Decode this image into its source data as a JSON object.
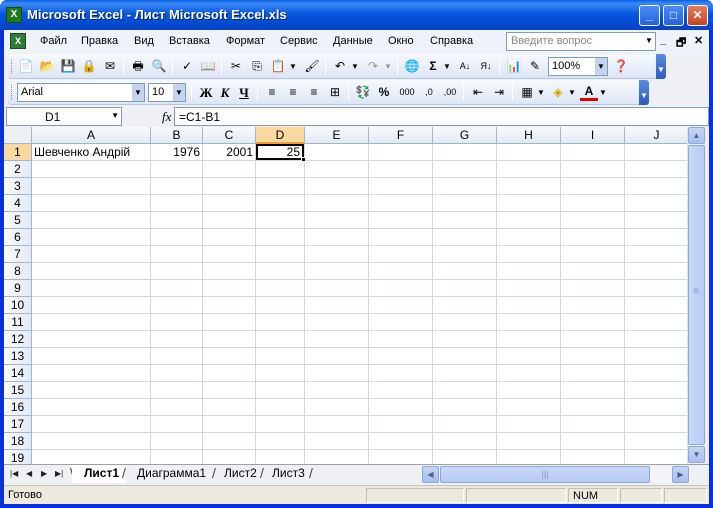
{
  "window": {
    "title": "Microsoft Excel - Лист Microsoft Excel.xls",
    "minimize": "_",
    "maximize": "□",
    "close": "✕"
  },
  "menu": {
    "items": [
      "Файл",
      "Правка",
      "Вид",
      "Вставка",
      "Формат",
      "Сервис",
      "Данные",
      "Окно",
      "Справка"
    ],
    "help_placeholder": "Введите вопрос",
    "doc_controls": [
      "_",
      "🗗",
      "✕"
    ]
  },
  "toolbar_standard": {
    "zoom": "100%"
  },
  "toolbar_format": {
    "font": "Arial",
    "size": "10",
    "bold": "Ж",
    "italic": "К",
    "underline": "Ч",
    "percent": "%",
    "thousands": "000"
  },
  "formula_bar": {
    "name_box": "D1",
    "fx": "fx",
    "formula": "=C1-B1"
  },
  "columns": [
    "A",
    "B",
    "C",
    "D",
    "E",
    "F",
    "G",
    "H",
    "I",
    "J"
  ],
  "rows": [
    "1",
    "2",
    "3",
    "4",
    "5",
    "6",
    "7",
    "8",
    "9",
    "10",
    "11",
    "12",
    "13",
    "14",
    "15",
    "16",
    "17",
    "18",
    "19"
  ],
  "cells": {
    "A1": "Шевченко Андрій",
    "B1": "1976",
    "C1": "2001",
    "D1": "25"
  },
  "active_cell": "D1",
  "sheet_tabs": [
    "Лист1",
    "Диаграмма1",
    "Лист2",
    "Лист3"
  ],
  "active_tab": "Лист1",
  "status": {
    "text": "Готово",
    "num": "NUM"
  }
}
